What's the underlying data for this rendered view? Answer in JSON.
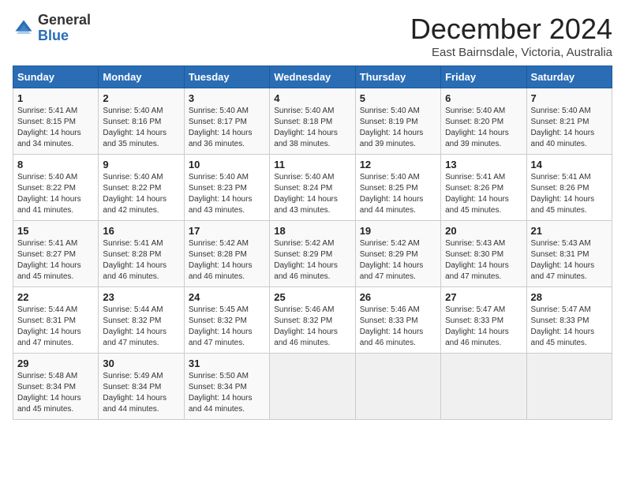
{
  "header": {
    "logo_general": "General",
    "logo_blue": "Blue",
    "month_title": "December 2024",
    "location": "East Bairnsdale, Victoria, Australia"
  },
  "calendar": {
    "days_of_week": [
      "Sunday",
      "Monday",
      "Tuesday",
      "Wednesday",
      "Thursday",
      "Friday",
      "Saturday"
    ],
    "weeks": [
      [
        {
          "num": "",
          "info": ""
        },
        {
          "num": "2",
          "info": "Sunrise: 5:40 AM\nSunset: 8:16 PM\nDaylight: 14 hours\nand 35 minutes."
        },
        {
          "num": "3",
          "info": "Sunrise: 5:40 AM\nSunset: 8:17 PM\nDaylight: 14 hours\nand 36 minutes."
        },
        {
          "num": "4",
          "info": "Sunrise: 5:40 AM\nSunset: 8:18 PM\nDaylight: 14 hours\nand 38 minutes."
        },
        {
          "num": "5",
          "info": "Sunrise: 5:40 AM\nSunset: 8:19 PM\nDaylight: 14 hours\nand 39 minutes."
        },
        {
          "num": "6",
          "info": "Sunrise: 5:40 AM\nSunset: 8:20 PM\nDaylight: 14 hours\nand 39 minutes."
        },
        {
          "num": "7",
          "info": "Sunrise: 5:40 AM\nSunset: 8:21 PM\nDaylight: 14 hours\nand 40 minutes."
        }
      ],
      [
        {
          "num": "1",
          "info": "Sunrise: 5:41 AM\nSunset: 8:15 PM\nDaylight: 14 hours\nand 34 minutes."
        },
        null,
        null,
        null,
        null,
        null,
        null
      ],
      [
        {
          "num": "8",
          "info": "Sunrise: 5:40 AM\nSunset: 8:22 PM\nDaylight: 14 hours\nand 41 minutes."
        },
        {
          "num": "9",
          "info": "Sunrise: 5:40 AM\nSunset: 8:22 PM\nDaylight: 14 hours\nand 42 minutes."
        },
        {
          "num": "10",
          "info": "Sunrise: 5:40 AM\nSunset: 8:23 PM\nDaylight: 14 hours\nand 43 minutes."
        },
        {
          "num": "11",
          "info": "Sunrise: 5:40 AM\nSunset: 8:24 PM\nDaylight: 14 hours\nand 43 minutes."
        },
        {
          "num": "12",
          "info": "Sunrise: 5:40 AM\nSunset: 8:25 PM\nDaylight: 14 hours\nand 44 minutes."
        },
        {
          "num": "13",
          "info": "Sunrise: 5:41 AM\nSunset: 8:26 PM\nDaylight: 14 hours\nand 45 minutes."
        },
        {
          "num": "14",
          "info": "Sunrise: 5:41 AM\nSunset: 8:26 PM\nDaylight: 14 hours\nand 45 minutes."
        }
      ],
      [
        {
          "num": "15",
          "info": "Sunrise: 5:41 AM\nSunset: 8:27 PM\nDaylight: 14 hours\nand 45 minutes."
        },
        {
          "num": "16",
          "info": "Sunrise: 5:41 AM\nSunset: 8:28 PM\nDaylight: 14 hours\nand 46 minutes."
        },
        {
          "num": "17",
          "info": "Sunrise: 5:42 AM\nSunset: 8:28 PM\nDaylight: 14 hours\nand 46 minutes."
        },
        {
          "num": "18",
          "info": "Sunrise: 5:42 AM\nSunset: 8:29 PM\nDaylight: 14 hours\nand 46 minutes."
        },
        {
          "num": "19",
          "info": "Sunrise: 5:42 AM\nSunset: 8:29 PM\nDaylight: 14 hours\nand 47 minutes."
        },
        {
          "num": "20",
          "info": "Sunrise: 5:43 AM\nSunset: 8:30 PM\nDaylight: 14 hours\nand 47 minutes."
        },
        {
          "num": "21",
          "info": "Sunrise: 5:43 AM\nSunset: 8:31 PM\nDaylight: 14 hours\nand 47 minutes."
        }
      ],
      [
        {
          "num": "22",
          "info": "Sunrise: 5:44 AM\nSunset: 8:31 PM\nDaylight: 14 hours\nand 47 minutes."
        },
        {
          "num": "23",
          "info": "Sunrise: 5:44 AM\nSunset: 8:32 PM\nDaylight: 14 hours\nand 47 minutes."
        },
        {
          "num": "24",
          "info": "Sunrise: 5:45 AM\nSunset: 8:32 PM\nDaylight: 14 hours\nand 47 minutes."
        },
        {
          "num": "25",
          "info": "Sunrise: 5:46 AM\nSunset: 8:32 PM\nDaylight: 14 hours\nand 46 minutes."
        },
        {
          "num": "26",
          "info": "Sunrise: 5:46 AM\nSunset: 8:33 PM\nDaylight: 14 hours\nand 46 minutes."
        },
        {
          "num": "27",
          "info": "Sunrise: 5:47 AM\nSunset: 8:33 PM\nDaylight: 14 hours\nand 46 minutes."
        },
        {
          "num": "28",
          "info": "Sunrise: 5:47 AM\nSunset: 8:33 PM\nDaylight: 14 hours\nand 45 minutes."
        }
      ],
      [
        {
          "num": "29",
          "info": "Sunrise: 5:48 AM\nSunset: 8:34 PM\nDaylight: 14 hours\nand 45 minutes."
        },
        {
          "num": "30",
          "info": "Sunrise: 5:49 AM\nSunset: 8:34 PM\nDaylight: 14 hours\nand 44 minutes."
        },
        {
          "num": "31",
          "info": "Sunrise: 5:50 AM\nSunset: 8:34 PM\nDaylight: 14 hours\nand 44 minutes."
        },
        {
          "num": "",
          "info": ""
        },
        {
          "num": "",
          "info": ""
        },
        {
          "num": "",
          "info": ""
        },
        {
          "num": "",
          "info": ""
        }
      ]
    ]
  }
}
